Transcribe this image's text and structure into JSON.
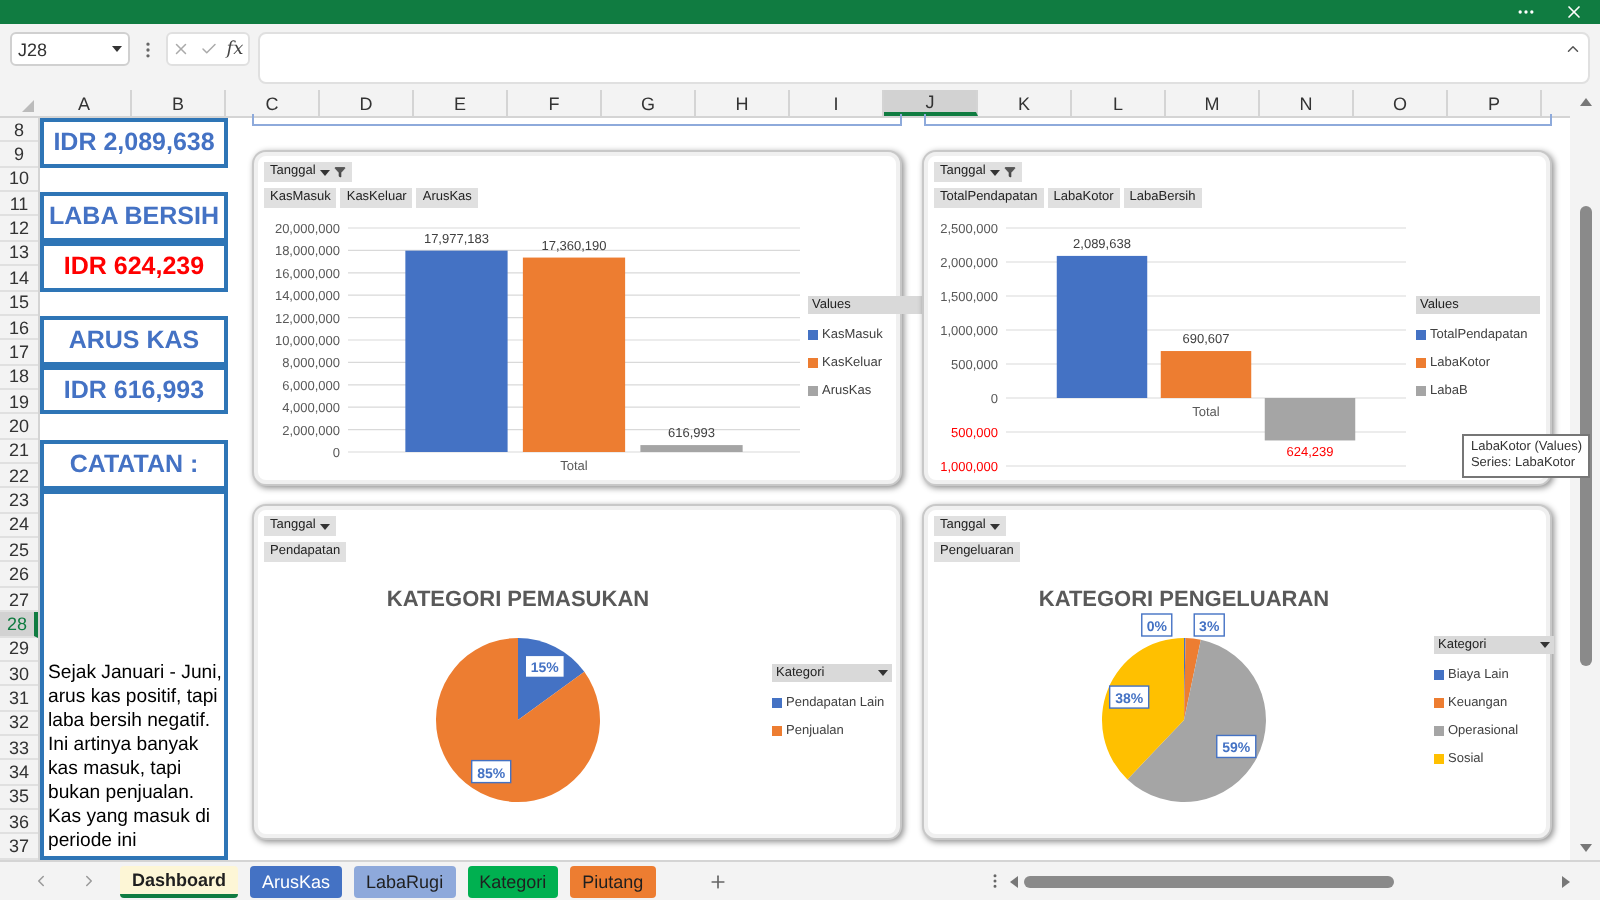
{
  "name_box": {
    "value": "J28"
  },
  "formula_bar": {
    "fx_label": "fx"
  },
  "column_headers": [
    {
      "label": "A",
      "selected": false
    },
    {
      "label": "B",
      "selected": false
    },
    {
      "label": "C",
      "selected": false
    },
    {
      "label": "D",
      "selected": false
    },
    {
      "label": "E",
      "selected": false
    },
    {
      "label": "F",
      "selected": false
    },
    {
      "label": "G",
      "selected": false
    },
    {
      "label": "H",
      "selected": false
    },
    {
      "label": "I",
      "selected": false
    },
    {
      "label": "J",
      "selected": true
    },
    {
      "label": "K",
      "selected": false
    },
    {
      "label": "L",
      "selected": false
    },
    {
      "label": "M",
      "selected": false
    },
    {
      "label": "N",
      "selected": false
    },
    {
      "label": "O",
      "selected": false
    },
    {
      "label": "P",
      "selected": false
    }
  ],
  "row_headers": [
    {
      "label": "8",
      "selected": false
    },
    {
      "label": "9",
      "selected": false
    },
    {
      "label": "10",
      "selected": false
    },
    {
      "label": "11",
      "selected": false
    },
    {
      "label": "12",
      "selected": false
    },
    {
      "label": "13",
      "selected": false
    },
    {
      "label": "14",
      "selected": false
    },
    {
      "label": "15",
      "selected": false
    },
    {
      "label": "16",
      "selected": false
    },
    {
      "label": "17",
      "selected": false
    },
    {
      "label": "18",
      "selected": false
    },
    {
      "label": "19",
      "selected": false
    },
    {
      "label": "20",
      "selected": false
    },
    {
      "label": "21",
      "selected": false
    },
    {
      "label": "22",
      "selected": false
    },
    {
      "label": "23",
      "selected": false
    },
    {
      "label": "24",
      "selected": false
    },
    {
      "label": "25",
      "selected": false
    },
    {
      "label": "26",
      "selected": false
    },
    {
      "label": "27",
      "selected": false
    },
    {
      "label": "28",
      "selected": true
    },
    {
      "label": "29",
      "selected": false
    },
    {
      "label": "30",
      "selected": false
    },
    {
      "label": "31",
      "selected": false
    },
    {
      "label": "32",
      "selected": false
    },
    {
      "label": "33",
      "selected": false
    },
    {
      "label": "34",
      "selected": false
    },
    {
      "label": "35",
      "selected": false
    },
    {
      "label": "36",
      "selected": false
    },
    {
      "label": "37",
      "selected": false
    }
  ],
  "summary_cells": [
    {
      "kind": "value",
      "text": "IDR 2,089,638",
      "color": "#4472c4"
    },
    {
      "kind": "heading",
      "text": "LABA BERSIH",
      "color": "#4472c4"
    },
    {
      "kind": "value",
      "text": "IDR 624,239",
      "color": "#ff0000"
    },
    {
      "kind": "heading",
      "text": "ARUS KAS",
      "color": "#4472c4"
    },
    {
      "kind": "value",
      "text": "IDR 616,993",
      "color": "#4472c4"
    },
    {
      "kind": "heading",
      "text": "CATATAN :",
      "color": "#4472c4"
    },
    {
      "kind": "note",
      "text": "Sejak Januari - Juni, arus kas positif, tapi laba bersih negatif. Ini artinya banyak kas masuk, tapi bukan penjualan. Kas yang masuk di periode ini",
      "color": "#000000"
    }
  ],
  "charts": [
    {
      "filter_button": {
        "label": "Tanggal",
        "filtered": true
      },
      "legend": {
        "kind": "values",
        "title": "Values",
        "items": [
          {
            "label": "KasMasuk"
          },
          {
            "label": "KasKeluar"
          },
          {
            "label": "ArusKas"
          }
        ]
      },
      "chart_data": {
        "type": "bar",
        "categories": [
          "Total"
        ],
        "series": [
          {
            "name": "KasMasuk",
            "color": "#4472c4",
            "values": [
              17977183
            ]
          },
          {
            "name": "KasKeluar",
            "color": "#ed7d31",
            "values": [
              17360190
            ]
          },
          {
            "name": "ArusKas",
            "color": "#a5a5a5",
            "values": [
              616993
            ]
          }
        ],
        "ylim": [
          0,
          20000000
        ],
        "yticks": [
          {
            "value": 0,
            "label": "0"
          },
          {
            "value": 2000000,
            "label": "2,000,000"
          },
          {
            "value": 4000000,
            "label": "4,000,000"
          },
          {
            "value": 6000000,
            "label": "6,000,000"
          },
          {
            "value": 8000000,
            "label": "8,000,000"
          },
          {
            "value": 10000000,
            "label": "10,000,000"
          },
          {
            "value": 12000000,
            "label": "12,000,000"
          },
          {
            "value": 14000000,
            "label": "14,000,000"
          },
          {
            "value": 16000000,
            "label": "16,000,000"
          },
          {
            "value": 18000000,
            "label": "18,000,000"
          },
          {
            "value": 20000000,
            "label": "20,000,000"
          }
        ],
        "grid": true,
        "value_labels": [
          [
            "17,977,183"
          ],
          [
            "17,360,190"
          ],
          [
            "616,993"
          ]
        ]
      }
    },
    {
      "filter_button": {
        "label": "Tanggal",
        "filtered": true
      },
      "legend": {
        "kind": "values",
        "title": "Values",
        "items": [
          {
            "label": "TotalPendapatan"
          },
          {
            "label": "LabaKotor"
          },
          {
            "label": "LabaB"
          }
        ]
      },
      "tooltip": {
        "title": "LabaKotor (Values)",
        "subtitle": "Series: LabaKotor"
      },
      "chart_data": {
        "type": "bar",
        "categories": [
          "Total"
        ],
        "series": [
          {
            "name": "TotalPendapatan",
            "color": "#4472c4",
            "values": [
              2089638
            ]
          },
          {
            "name": "LabaKotor",
            "color": "#ed7d31",
            "values": [
              690607
            ]
          },
          {
            "name": "LabaBersih",
            "color": "#a5a5a5",
            "values": [
              -624239
            ]
          }
        ],
        "ylim": [
          -1000000,
          2500000
        ],
        "yticks": [
          {
            "value": -1000000,
            "label": "1,000,000"
          },
          {
            "value": -500000,
            "label": "500,000"
          },
          {
            "value": 0,
            "label": "0"
          },
          {
            "value": 500000,
            "label": "500,000"
          },
          {
            "value": 1000000,
            "label": "1,000,000"
          },
          {
            "value": 1500000,
            "label": "1,500,000"
          },
          {
            "value": 2000000,
            "label": "2,000,000"
          },
          {
            "value": 2500000,
            "label": "2,500,000"
          }
        ],
        "grid": true,
        "value_labels": [
          [
            "2,089,638"
          ],
          [
            "690,607"
          ],
          [
            "624,239"
          ]
        ]
      }
    },
    {
      "filter_button": {
        "label": "Tanggal",
        "filtered": false
      },
      "legend": {
        "kind": "field",
        "title": "Kategori",
        "items": [
          {
            "color": "#4472c4"
          },
          {
            "color": "#ed7d31"
          }
        ]
      },
      "chart_data": {
        "type": "pie",
        "title": "KATEGORI PEMASUKAN",
        "categories": [
          "Pendapatan Lain",
          "Penjualan"
        ],
        "series": [
          {
            "name": "Pendapatan",
            "values": [
              15,
              85
            ]
          }
        ],
        "value_labels": [
          "15%",
          "85%"
        ]
      }
    },
    {
      "filter_button": {
        "label": "Tanggal",
        "filtered": false
      },
      "legend": {
        "kind": "field",
        "title": "Kategori",
        "items": [
          {
            "color": "#4472c4"
          },
          {
            "color": "#ed7d31"
          },
          {
            "color": "#a5a5a5"
          },
          {
            "color": "#ffc000"
          }
        ]
      },
      "chart_data": {
        "type": "pie",
        "title": "KATEGORI PENGELUARAN",
        "categories": [
          "Biaya Lain",
          "Keuangan",
          "Operasional",
          "Sosial"
        ],
        "series": [
          {
            "name": "Pengeluaran",
            "values": [
              0.3,
              3,
              59,
              38
            ]
          }
        ],
        "value_labels": [
          "0%",
          "3%",
          "59%",
          "38%"
        ]
      }
    }
  ],
  "sheet_tabs": [
    {
      "label": "Dashboard",
      "selected": true
    },
    {
      "label": "ArusKas",
      "selected": false,
      "color": "#4472c4"
    },
    {
      "label": "LabaRugi",
      "selected": false,
      "color": "#8ea9db"
    },
    {
      "label": "Kategori",
      "selected": false,
      "color": "#00b050"
    },
    {
      "label": "Piutang",
      "selected": false,
      "color": "#ed7d31"
    }
  ]
}
